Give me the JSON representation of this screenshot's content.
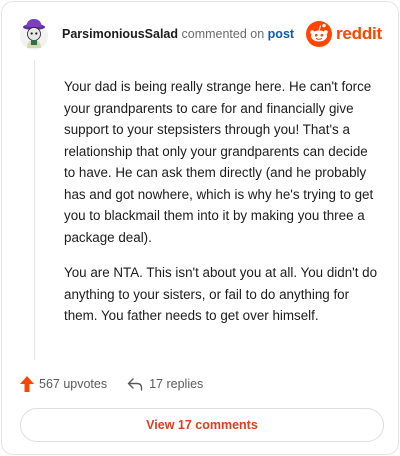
{
  "header": {
    "author": "ParsimoniousSalad",
    "action_text": "commented on",
    "target_link": "post",
    "brand": "reddit"
  },
  "comment": {
    "paragraphs": [
      "Your dad is being really strange here. He can't force your grandparents to care for and financially give support to your stepsisters through you! That's a relationship that only your grandparents can decide to have. He can ask them directly (and he probably has and got nowhere, which is why he's trying to get you to blackmail them into it by making you three a package deal).",
      "You are NTA. This isn't about you at all. You didn't do anything to your sisters, or fail to do anything for them. You father needs to get over himself."
    ]
  },
  "actions": {
    "upvotes": "567 upvotes",
    "replies": "17 replies",
    "view_comments": "View 17 comments"
  },
  "colors": {
    "brand": "#ff4500",
    "link": "#0f5aa8",
    "button_text": "#d9411e",
    "avatar_hat": "#7b3fbf"
  },
  "icons": [
    "avatar",
    "reddit-logo-icon",
    "upvote-arrow-icon",
    "reply-arrow-icon"
  ]
}
